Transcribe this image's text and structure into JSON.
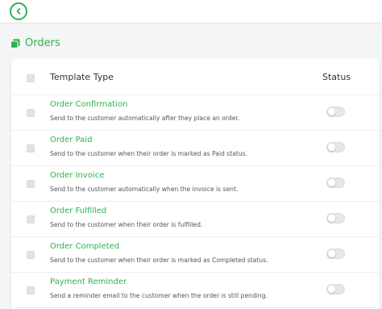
{
  "section": {
    "title": "Orders"
  },
  "table": {
    "header_type": "Template Type",
    "header_status": "Status",
    "rows": [
      {
        "title": "Order Confirmation",
        "desc": "Send to the customer automatically after they place an order.",
        "enabled": false
      },
      {
        "title": "Order Paid",
        "desc": "Send to the customer when their order is marked as Paid status.",
        "enabled": false
      },
      {
        "title": "Order Invoice",
        "desc": "Send to the customer automatically when the invoice is sent.",
        "enabled": false
      },
      {
        "title": "Order Fulfilled",
        "desc": "Send to the customer when their order is fulfilled.",
        "enabled": false
      },
      {
        "title": "Order Completed",
        "desc": "Send to the customer when their order is marked as Completed status.",
        "enabled": false
      },
      {
        "title": "Payment Reminder",
        "desc": "Send a reminder email to the customer when the order is still pending.",
        "enabled": false
      }
    ]
  },
  "colors": {
    "accent": "#2fb24c",
    "background": "#f4f5f7"
  }
}
